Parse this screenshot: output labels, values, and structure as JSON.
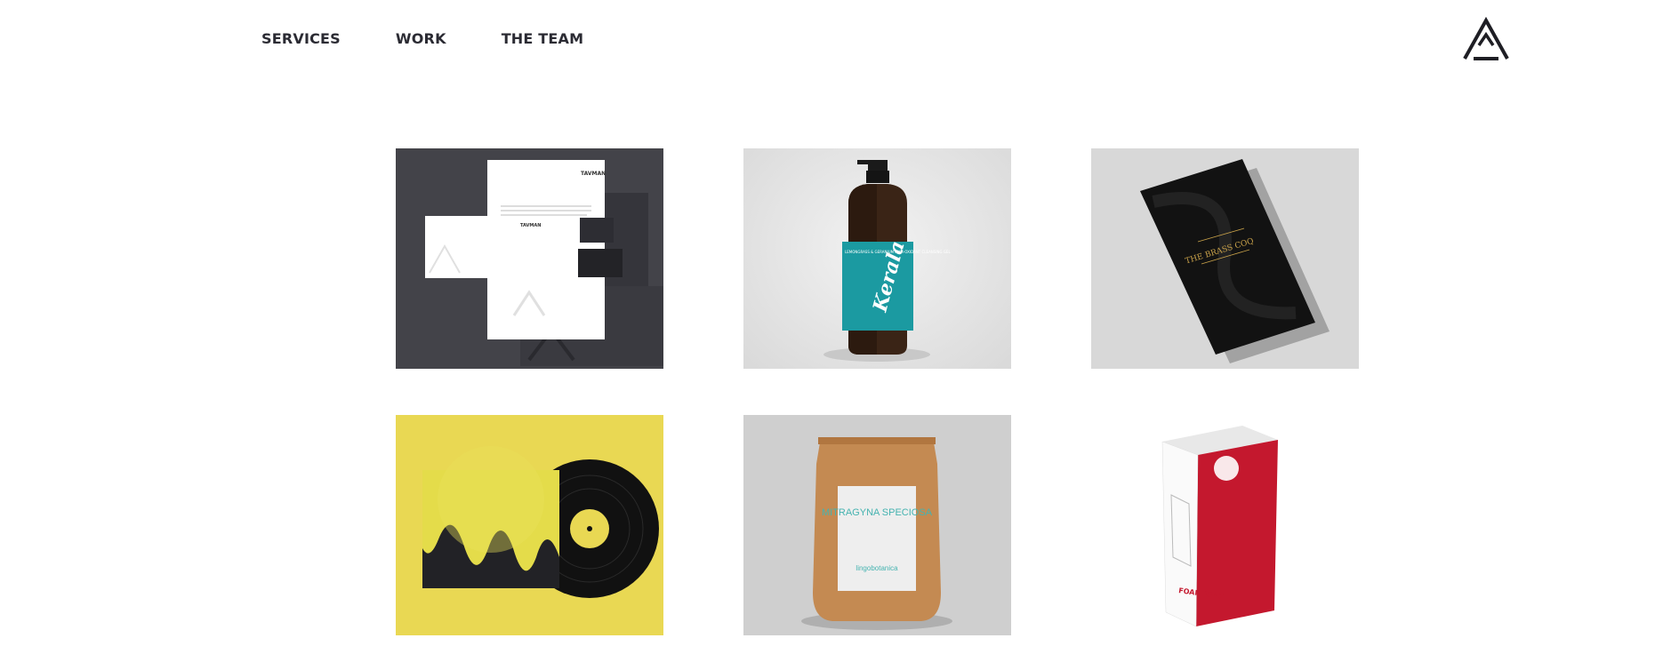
{
  "nav": {
    "items": [
      {
        "label": "SERVICES"
      },
      {
        "label": "WORK"
      },
      {
        "label": "THE TEAM"
      }
    ]
  },
  "logo": {
    "icon": "triangle-logo-icon"
  },
  "portfolio": {
    "items": [
      {
        "name": "stationery-mockup",
        "brand": "TAVMAN"
      },
      {
        "name": "bottle-mockup",
        "brand": "Kerala",
        "text": "LEMONGRASS & GERANIUM ANTI-OXIDANT CLEANSING GEL"
      },
      {
        "name": "menu-mockup",
        "brand": "THE BRASS COQ"
      },
      {
        "name": "vinyl-mockup"
      },
      {
        "name": "pouch-mockup",
        "text": "MITRAGYNA SPECIOSA",
        "brand": "lingobotanica"
      },
      {
        "name": "box-mockup",
        "brand": "FOAM KING"
      }
    ]
  },
  "colors": {
    "nav_text": "#2b2b33",
    "teal": "#1b9aa1",
    "yellow": "#e9d853",
    "red": "#c4182e",
    "charcoal": "#434349"
  }
}
